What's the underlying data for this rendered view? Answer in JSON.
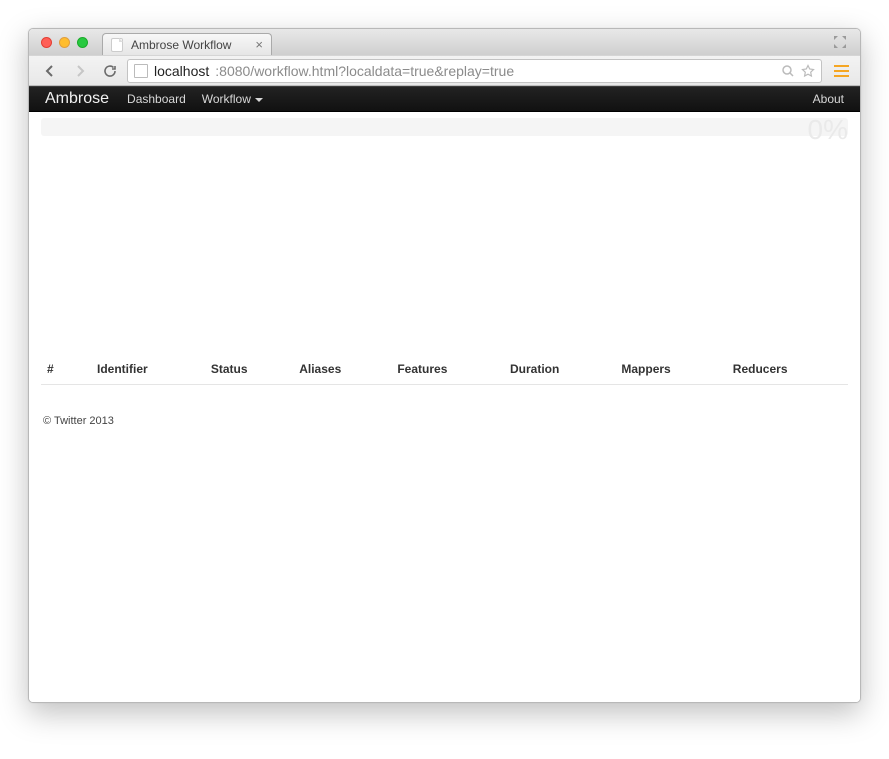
{
  "browser": {
    "tab_title": "Ambrose Workflow",
    "url_host": "localhost",
    "url_path": ":8080/workflow.html?localdata=true&replay=true"
  },
  "navbar": {
    "brand": "Ambrose",
    "links": {
      "dashboard": "Dashboard",
      "workflow": "Workflow"
    },
    "about": "About"
  },
  "progress": {
    "percent_label": "0%"
  },
  "table": {
    "headers": {
      "num": "#",
      "identifier": "Identifier",
      "status": "Status",
      "aliases": "Aliases",
      "features": "Features",
      "duration": "Duration",
      "mappers": "Mappers",
      "reducers": "Reducers"
    }
  },
  "footer": {
    "copyright": "© Twitter 2013"
  }
}
